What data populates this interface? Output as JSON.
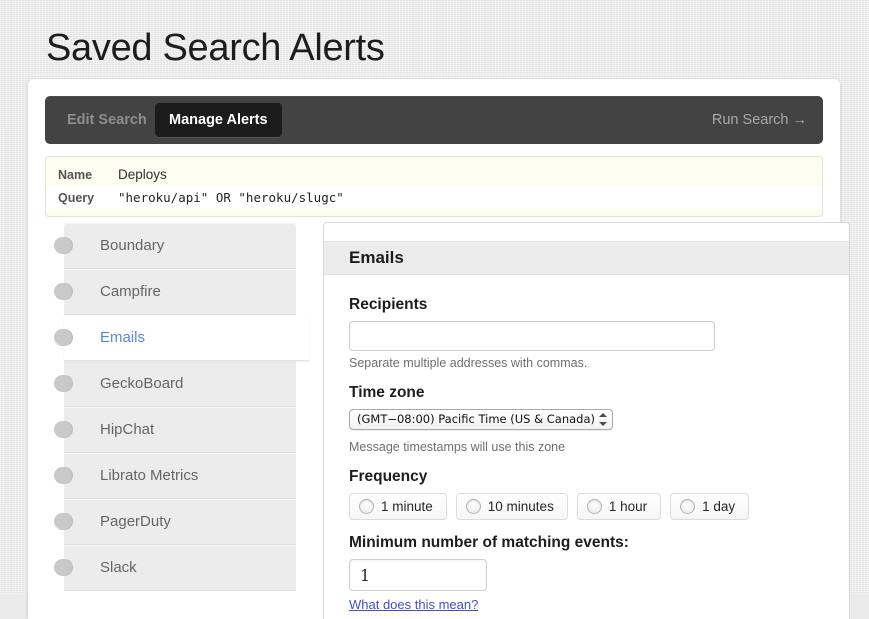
{
  "page": {
    "title": "Saved Search Alerts"
  },
  "tabbar": {
    "tabs": [
      {
        "label": "Edit Search",
        "active": false
      },
      {
        "label": "Manage Alerts",
        "active": true
      }
    ],
    "run_search_label": "Run Search →"
  },
  "summary": {
    "rows": [
      {
        "label": "Name",
        "value": "Deploys"
      },
      {
        "label": "Query",
        "value": "\"heroku/api\" OR \"heroku/slugc\""
      }
    ]
  },
  "sidebar": {
    "items": [
      {
        "label": "Boundary",
        "active": false
      },
      {
        "label": "Campfire",
        "active": false
      },
      {
        "label": "Emails",
        "active": true
      },
      {
        "label": "GeckoBoard",
        "active": false
      },
      {
        "label": "HipChat",
        "active": false
      },
      {
        "label": "Librato Metrics",
        "active": false
      },
      {
        "label": "PagerDuty",
        "active": false
      },
      {
        "label": "Slack",
        "active": false
      }
    ]
  },
  "panel": {
    "header": "Emails",
    "recipients": {
      "label": "Recipients",
      "value": "",
      "placeholder": "",
      "hint": "Separate multiple addresses with commas."
    },
    "timezone": {
      "label": "Time zone",
      "selected": "(GMT−08:00) Pacific Time (US & Canada)",
      "hint": "Message timestamps will use this zone"
    },
    "frequency": {
      "label": "Frequency",
      "options": [
        {
          "label": "1 minute",
          "selected": false
        },
        {
          "label": "10 minutes",
          "selected": false
        },
        {
          "label": "1 hour",
          "selected": false
        },
        {
          "label": "1 day",
          "selected": false
        }
      ]
    },
    "minimum_events": {
      "label": "Minimum number of matching events:",
      "value": "1",
      "help_link": "What does this mean?"
    }
  },
  "colors": {
    "page_background": "#ebeaea",
    "tabbar_background": "#444343",
    "active_tab_background": "#1c1c1c",
    "summary_background": "#fdfdf2",
    "active_sidebar_text": "#5b86d6",
    "link": "#3f51c4",
    "panel_header_background": "#ececec"
  }
}
